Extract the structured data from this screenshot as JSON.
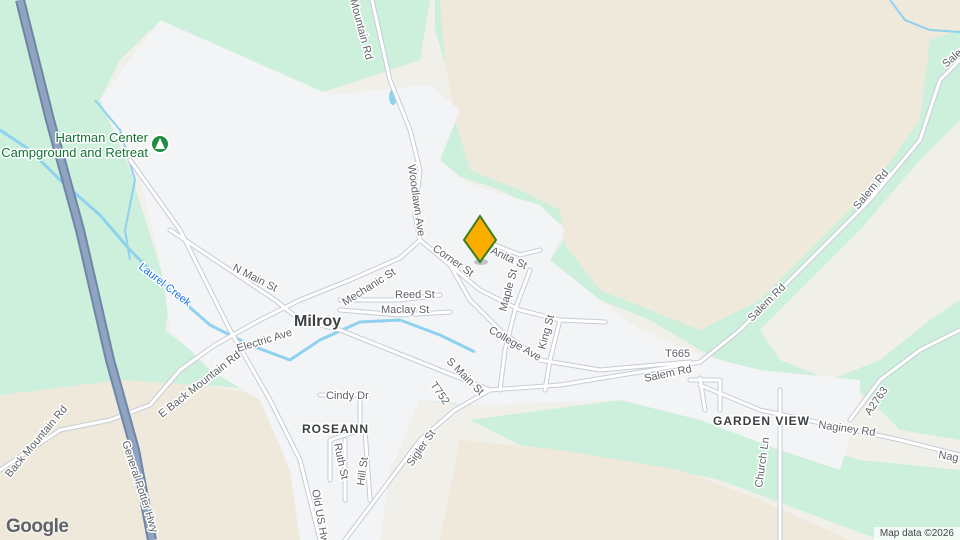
{
  "map": {
    "colors": {
      "forest": "#ccf0dc",
      "land": "#f1efe9",
      "open_field": "#efe9dc",
      "urban": "#f3f4f5",
      "road": "#ffffff",
      "road_edge": "#c7ccd3",
      "water": "#8ed2f0",
      "highway": "#8fa4c0",
      "marker": "#fbad00",
      "marker_edge": "#3a7d1c"
    },
    "labels": {
      "town": "Milroy",
      "district_roseann": "ROSEANN",
      "district_garden_view": "GARDEN VIEW",
      "poi_line1": "Hartman Center",
      "poi_line2": "Campground and Retreat",
      "creek": "Laurel Creek",
      "streets": {
        "mountain_rd": "Mountain Rd",
        "woodlawn_ave": "Woodlawn Ave",
        "anita_st": "Anita St",
        "corner_st": "Corner St",
        "n_main_st": "N Main St",
        "mechanic_st": "Mechanic St",
        "reed_st": "Reed St",
        "maclay_st": "Maclay St",
        "maple_st": "Maple St",
        "king_st": "King St",
        "college_ave": "College Ave",
        "electric_ave": "Electric Ave",
        "e_back_mountain_rd": "E Back Mountain Rd",
        "back_mountain_rd": "Back Mountain Rd",
        "s_main_st": "S Main St",
        "t752": "T752",
        "cindy_dr": "Cindy Dr",
        "sigler_st": "Sigler St",
        "ruth_st": "Ruth St",
        "hill_st": "Hill St",
        "old_us_hwy": "Old US Hwy",
        "general_potter_hwy": "General Potter Hwy",
        "salem_rd_1": "Salem Rd",
        "salem_rd_2": "Salem Rd",
        "salem_rd_3": "Salem Rd",
        "salem_edge": "Salem",
        "t665": "T665",
        "church_ln": "Church Ln",
        "naginey_rd": "Naginey Rd",
        "naginey_edge": "Nag",
        "a2763": "A2763"
      }
    },
    "brand": "Google",
    "attribution": "Map data ©2026",
    "icons": {
      "poi": "campground-icon",
      "marker": "location-pin-icon"
    }
  }
}
